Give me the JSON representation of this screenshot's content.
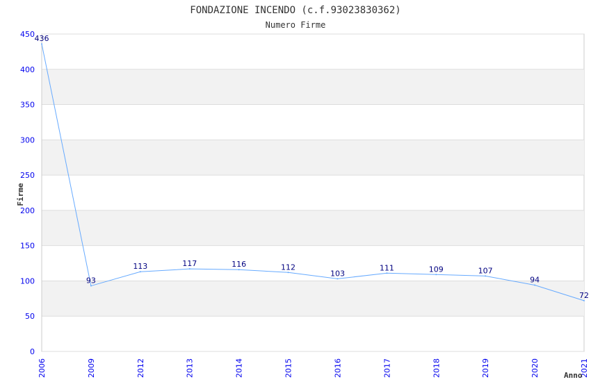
{
  "chart_data": {
    "type": "line",
    "title": "FONDAZIONE INCENDO (c.f.93023830362)",
    "subtitle": "Numero Firme",
    "xlabel": "Anno",
    "ylabel": "Firme",
    "categories": [
      "2006",
      "2009",
      "2012",
      "2013",
      "2014",
      "2015",
      "2016",
      "2017",
      "2018",
      "2019",
      "2020",
      "2021"
    ],
    "values": [
      436,
      93,
      113,
      117,
      116,
      112,
      103,
      111,
      109,
      107,
      94,
      72
    ],
    "ylim": [
      0,
      450
    ],
    "yticks": [
      0,
      50,
      100,
      150,
      200,
      250,
      300,
      350,
      400,
      450
    ],
    "grid": true,
    "data_labels": true,
    "colors": {
      "line": "#66aaff",
      "ticks": "#0000ee",
      "labels": "#000080",
      "band": "#f2f2f2",
      "grid": "#dddddd"
    }
  }
}
